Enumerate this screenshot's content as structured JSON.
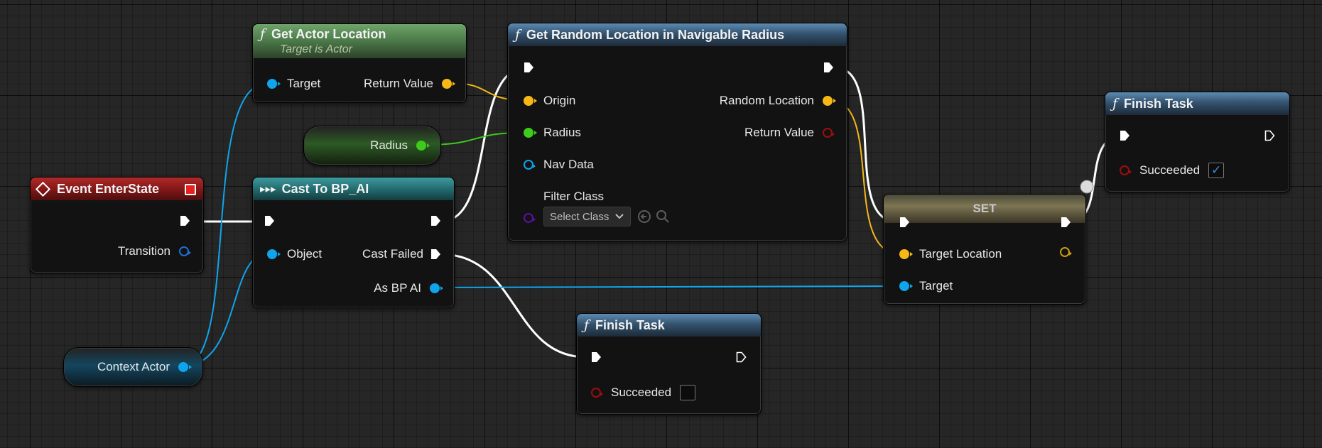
{
  "nodes": {
    "get_actor_location": {
      "title": "Get Actor Location",
      "subtitle": "Target is Actor",
      "in_target": "Target",
      "out_return": "Return Value"
    },
    "radius_var": {
      "label": "Radius"
    },
    "event_enter": {
      "title": "Event EnterState",
      "out_transition": "Transition"
    },
    "cast": {
      "title": "Cast To BP_AI",
      "in_object": "Object",
      "out_failed": "Cast Failed",
      "out_as": "As BP AI"
    },
    "context_actor": {
      "label": "Context Actor"
    },
    "get_random": {
      "title": "Get Random Location in Navigable Radius",
      "in_origin": "Origin",
      "in_radius": "Radius",
      "in_nav": "Nav Data",
      "in_filter": "Filter Class",
      "filter_select": "Select Class",
      "out_random": "Random Location",
      "out_return": "Return Value"
    },
    "set": {
      "title": "SET",
      "in_target_location": "Target Location",
      "in_target": "Target"
    },
    "finish_task_1": {
      "title": "Finish Task",
      "succeeded": "Succeeded",
      "checked": true
    },
    "finish_task_2": {
      "title": "Finish Task",
      "succeeded": "Succeeded",
      "checked": false
    }
  },
  "colors": {
    "vector": "#f5b817",
    "float": "#3ecb1c",
    "object": "#0ea5ec",
    "bool": "#9c0e0e",
    "class": "#5b0fa8",
    "exec": "#ffffff",
    "event_header": "#b02a2a",
    "function_header": "#34536f"
  },
  "icons": {
    "function": "function-icon",
    "event": "event-diamond-icon",
    "cast": "cast-arrow-icon",
    "stop": "stop-icon",
    "check": "checkmark-icon",
    "use": "use-selected-icon",
    "browse": "search-icon",
    "dropdown": "chevron-down-icon"
  }
}
